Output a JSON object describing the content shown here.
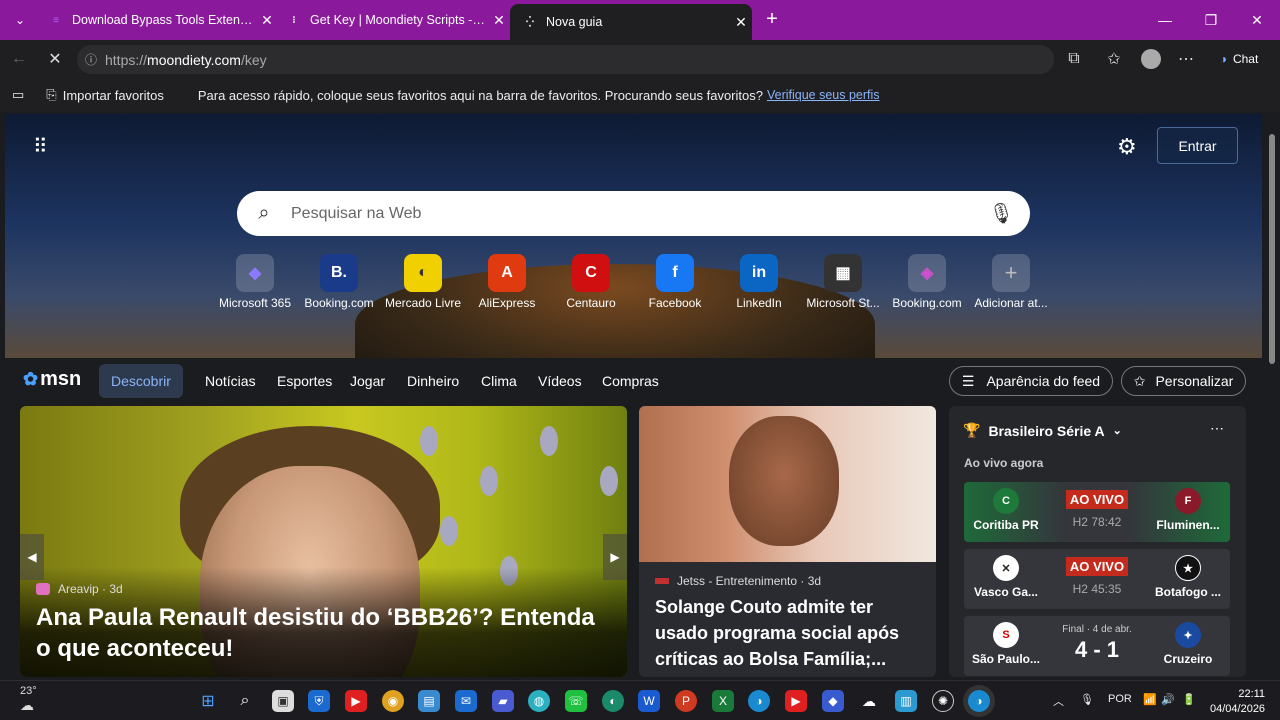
{
  "tabs": [
    {
      "label": "Download Bypass Tools Extension",
      "icon": "extension-tool-icon"
    },
    {
      "label": "Get Key | Moondiety Scripts - Best",
      "icon": "loading-dots-icon"
    },
    {
      "label": "Nova guia",
      "icon": "loading-spinner-icon"
    }
  ],
  "address": {
    "prefix": "https://",
    "host": "moondiety.com",
    "path": "/key"
  },
  "toolbar": {
    "chat_label": "Chat"
  },
  "favorites_bar": {
    "import_label": "Importar favoritos",
    "message": "Para acesso rápido, coloque seus favoritos aqui na barra de favoritos. Procurando seus favoritos?",
    "link": "Verifique seus perfis"
  },
  "newtab": {
    "signin_label": "Entrar",
    "search_placeholder": "Pesquisar na Web",
    "quick_links": [
      {
        "label": "Microsoft 365",
        "glyph": "◆",
        "color": "#6a5acd"
      },
      {
        "label": "Booking.com",
        "glyph": "B.",
        "color": "#1a3a8a"
      },
      {
        "label": "Mercado Livre",
        "glyph": "🤝",
        "color": "#f0d000"
      },
      {
        "label": "AliExpress",
        "glyph": "A",
        "color": "#e03a10"
      },
      {
        "label": "Centauro",
        "glyph": "C",
        "color": "#d01010"
      },
      {
        "label": "Facebook",
        "glyph": "f",
        "color": "#1877f2"
      },
      {
        "label": "LinkedIn",
        "glyph": "in",
        "color": "#0a66c2"
      },
      {
        "label": "Microsoft St...",
        "glyph": "▦",
        "color": "#333333"
      },
      {
        "label": "Booking.com",
        "glyph": "◈",
        "color": "#8a2a8a"
      },
      {
        "label": "Adicionar at...",
        "glyph": "+",
        "color": "#555555"
      }
    ]
  },
  "msn": {
    "logo_text": "msn",
    "nav": [
      "Descobrir",
      "Notícias",
      "Esportes",
      "Jogar",
      "Dinheiro",
      "Clima",
      "Vídeos",
      "Compras"
    ],
    "feed_button": "Aparência do feed",
    "personalize_button": "Personalizar"
  },
  "cards": [
    {
      "source": "Areavip",
      "age": "3d",
      "title": "Ana Paula Renault desistiu do ‘BBB26’? Entenda o que aconteceu!"
    },
    {
      "source": "Jetss - Entretenimento",
      "age": "3d",
      "title": "Solange Couto admite ter usado programa social após críticas ao Bolsa Família;..."
    }
  ],
  "sports": {
    "league": "Brasileiro Série A",
    "live_now": "Ao vivo agora",
    "matches": [
      {
        "home": "Coritiba PR",
        "away": "Fluminen...",
        "status": "AO VIVO",
        "clock": "H2 78:42"
      },
      {
        "home": "Vasco Ga...",
        "away": "Botafogo ...",
        "status": "AO VIVO",
        "clock": "H2 45:35"
      },
      {
        "home": "São Paulo...",
        "away": "Cruzeiro",
        "status": "Final · 4 de abr.",
        "score": "4 - 1"
      }
    ]
  },
  "taskbar": {
    "temperature": "23°",
    "language": "POR",
    "time": "22:11",
    "date": "04/04/2026"
  },
  "colors": {
    "titlebar": "#8a1a9b",
    "live_badge": "#c42b1c",
    "accent_link": "#8ab4f8"
  }
}
